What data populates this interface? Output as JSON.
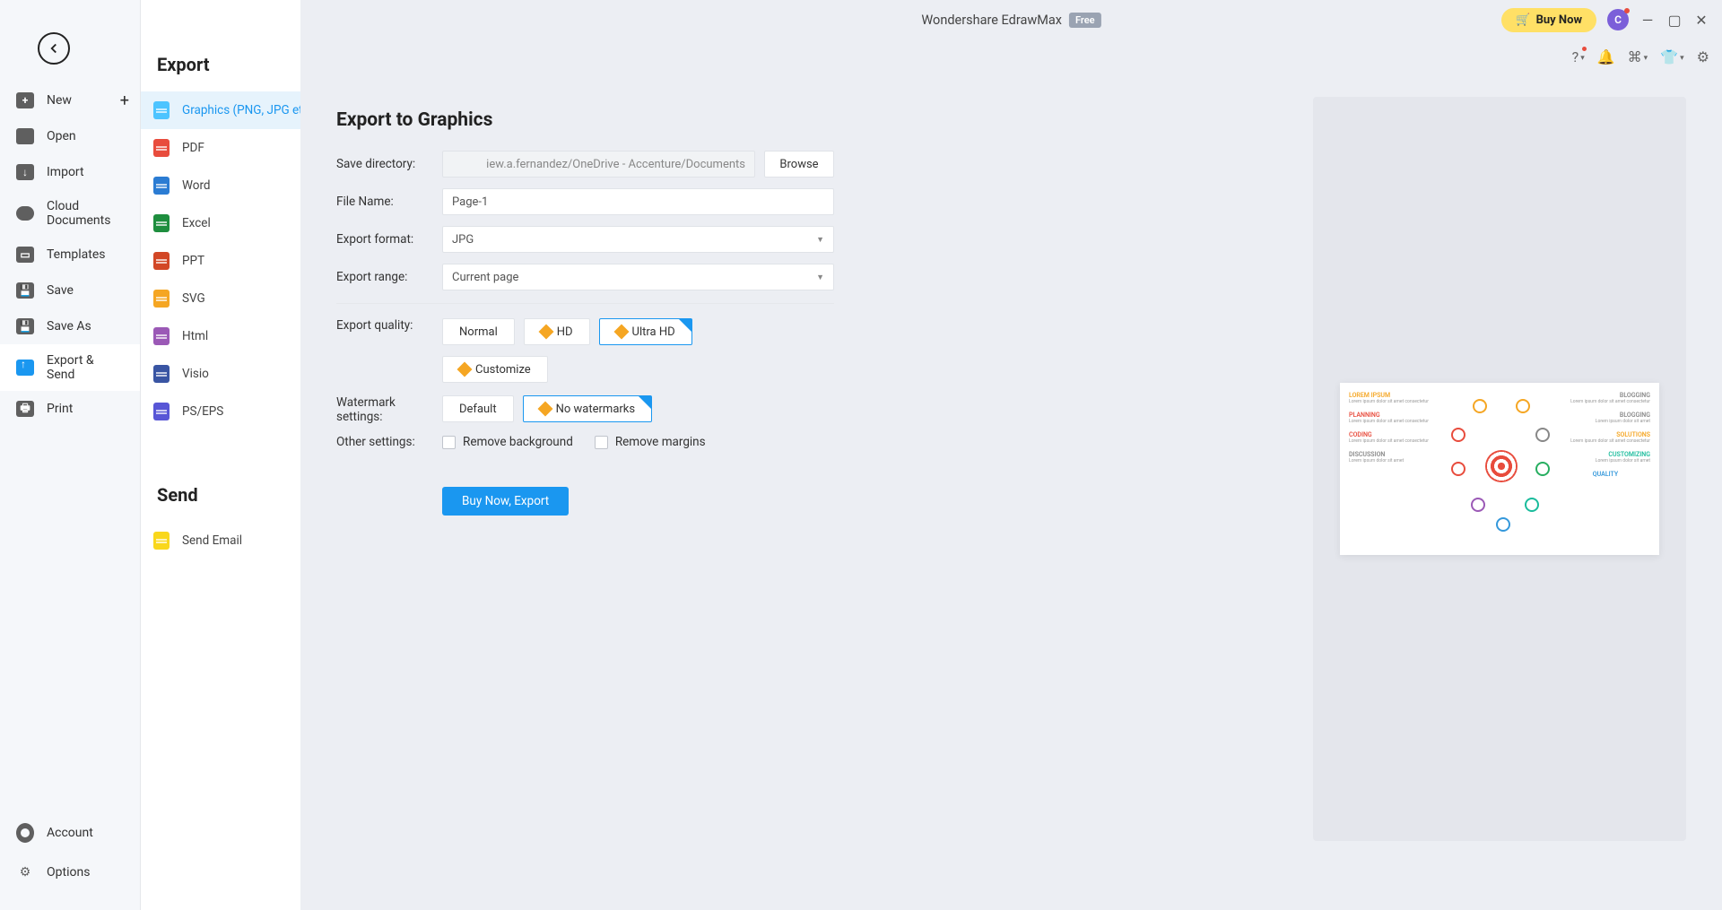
{
  "titlebar": {
    "app_name": "Wondershare EdrawMax",
    "free_badge": "Free",
    "buy_now": "Buy Now",
    "avatar_letter": "C"
  },
  "sidebar": {
    "items": [
      {
        "label": "New"
      },
      {
        "label": "Open"
      },
      {
        "label": "Import"
      },
      {
        "label": "Cloud Documents"
      },
      {
        "label": "Templates"
      },
      {
        "label": "Save"
      },
      {
        "label": "Save As"
      },
      {
        "label": "Export & Send"
      },
      {
        "label": "Print"
      }
    ],
    "bottom": [
      {
        "label": "Account"
      },
      {
        "label": "Options"
      }
    ]
  },
  "export_col": {
    "header": "Export",
    "send_header": "Send",
    "types": [
      {
        "label": "Graphics (PNG, JPG et..."
      },
      {
        "label": "PDF"
      },
      {
        "label": "Word"
      },
      {
        "label": "Excel"
      },
      {
        "label": "PPT"
      },
      {
        "label": "SVG"
      },
      {
        "label": "Html"
      },
      {
        "label": "Visio"
      },
      {
        "label": "PS/EPS"
      }
    ],
    "send_types": [
      {
        "label": "Send Email"
      }
    ]
  },
  "form": {
    "title": "Export to Graphics",
    "save_dir_label": "Save directory:",
    "save_dir_value": "iew.a.fernandez/OneDrive - Accenture/Documents",
    "browse": "Browse",
    "file_name_label": "File Name:",
    "file_name_value": "Page-1",
    "export_format_label": "Export format:",
    "export_format_value": "JPG",
    "export_range_label": "Export range:",
    "export_range_value": "Current page",
    "quality_label": "Export quality:",
    "quality_normal": "Normal",
    "quality_hd": "HD",
    "quality_ultra": "Ultra HD",
    "customize": "Customize",
    "watermark_label": "Watermark settings:",
    "watermark_default": "Default",
    "watermark_none": "No watermarks",
    "other_label": "Other settings:",
    "remove_bg": "Remove background",
    "remove_margins": "Remove margins",
    "export_btn": "Buy Now, Export"
  }
}
